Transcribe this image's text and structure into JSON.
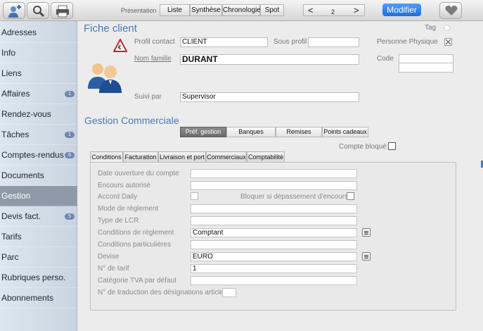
{
  "toolbar": {
    "presentation_label": "Présentation",
    "views": [
      "Liste",
      "Synthèse",
      "Chronologie",
      "Spot"
    ],
    "page_prev": "<",
    "page_number": "2",
    "page_next": ">",
    "modifier_label": "Modifier",
    "icons": [
      "add-contact-icon",
      "search-icon",
      "print-icon",
      "heart-icon"
    ],
    "accent_color": "#1a6fe0"
  },
  "sidebar": {
    "items": [
      {
        "label": "Adresses",
        "badge": ""
      },
      {
        "label": "Info",
        "badge": ""
      },
      {
        "label": "Liens",
        "badge": ""
      },
      {
        "label": "Affaires",
        "badge": "1"
      },
      {
        "label": "Rendez-vous",
        "badge": ""
      },
      {
        "label": "Tâches",
        "badge": "1"
      },
      {
        "label": "Comptes-rendus",
        "badge": "5"
      },
      {
        "label": "Documents",
        "badge": ""
      },
      {
        "label": "Gestion",
        "badge": ""
      },
      {
        "label": "Devis fact.",
        "badge": "5"
      },
      {
        "label": "Tarifs",
        "badge": ""
      },
      {
        "label": "Parc",
        "badge": ""
      },
      {
        "label": "Rubriques perso.",
        "badge": ""
      },
      {
        "label": "Abonnements",
        "badge": ""
      }
    ],
    "active": "Gestion"
  },
  "fiche": {
    "title": "Fiche client",
    "tag_label": "Tag",
    "profil_contact_label": "Profil contact",
    "profil_contact_value": "CLIENT",
    "sous_profil_label": "Sous profil",
    "sous_profil_value": "",
    "personne_physique_label": "Personne Physique",
    "nom_famille_label": "Nom famille",
    "nom_famille_value": "DURANT",
    "code_label": "Code",
    "code_value": "",
    "suivi_par_label": "Suivi par",
    "suivi_par_value": "Supervisor",
    "badge_icon_text": "€"
  },
  "gestion": {
    "title": "Gestion Commerciale",
    "subtabs": [
      "Préf. gestion",
      "Banques",
      "Remises",
      "Points cadeaux"
    ],
    "active_subtab": "Préf. gestion",
    "compte_bloque_label": "Compte bloqué",
    "tabs": [
      "Conditions",
      "Facturation",
      "Livraison et port",
      "Commerciaux",
      "Comptabilité"
    ],
    "active_tab": "Conditions",
    "rows": {
      "date_ouverture": {
        "label": "Date ouverture du compte",
        "value": ""
      },
      "encours": {
        "label": "Encours autorisé",
        "value": ""
      },
      "accord_daily": {
        "label": "Accord Daily"
      },
      "bloquer": {
        "label": "Bloquer si dépassement d'encours"
      },
      "mode_reglement": {
        "label": "Mode de règlement",
        "value": ""
      },
      "type_lcr": {
        "label": "Type de LCR",
        "value": ""
      },
      "conditions_reglement": {
        "label": "Conditions de règlement",
        "value": "Comptant"
      },
      "conditions_particulieres": {
        "label": "Conditions particulières",
        "value": ""
      },
      "devise": {
        "label": "Devise",
        "value": "EURO"
      },
      "num_tarif": {
        "label": "N° de tarif",
        "value": "1"
      },
      "categorie_tva": {
        "label": "Catégorie TVA par défaut",
        "value": ""
      },
      "num_traduction": {
        "label": "N° de traduction des désignations articles",
        "value": ""
      }
    }
  }
}
